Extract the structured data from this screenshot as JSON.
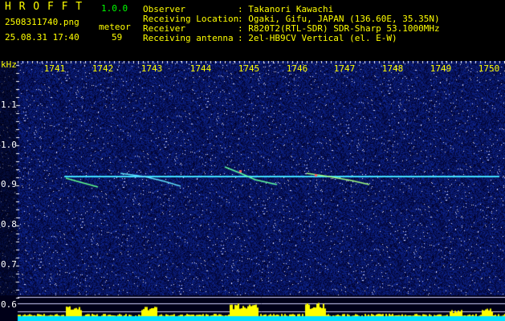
{
  "app": {
    "name": "H R O F F T",
    "version": "1.0.0"
  },
  "file": {
    "name": "2508311740.png",
    "datetime": "25.08.31 17:40"
  },
  "meteor": {
    "label": "meteor",
    "count": "59"
  },
  "info": [
    {
      "key": "Observer",
      "value": ": Takanori Kawachi"
    },
    {
      "key": "Receiving Location",
      "value": ": Ogaki, Gifu, JAPAN (136.60E, 35.35N)"
    },
    {
      "key": "Receiver",
      "value": ": R820T2(RTL-SDR) SDR-Sharp 53.1000MHz"
    },
    {
      "key": "Receiving antenna",
      "value": ": 2el-HB9CV Vertical (el. E-W)"
    }
  ],
  "axis": {
    "y_unit": "kHz",
    "x_ticks": [
      "1741",
      "1742",
      "1743",
      "1744",
      "1745",
      "1746",
      "1747",
      "1748",
      "1749",
      "1750"
    ],
    "y_ticks": [
      "1.1",
      "1.0",
      "0.9",
      "0.8",
      "0.7",
      "0.6"
    ]
  },
  "colors": {
    "header_text": "#ffff00",
    "version_text": "#00ff00",
    "background": "#000018",
    "carrier": "#40e0ff",
    "activity_bar": "#ffff00",
    "baseline": "#00e0ff"
  }
}
